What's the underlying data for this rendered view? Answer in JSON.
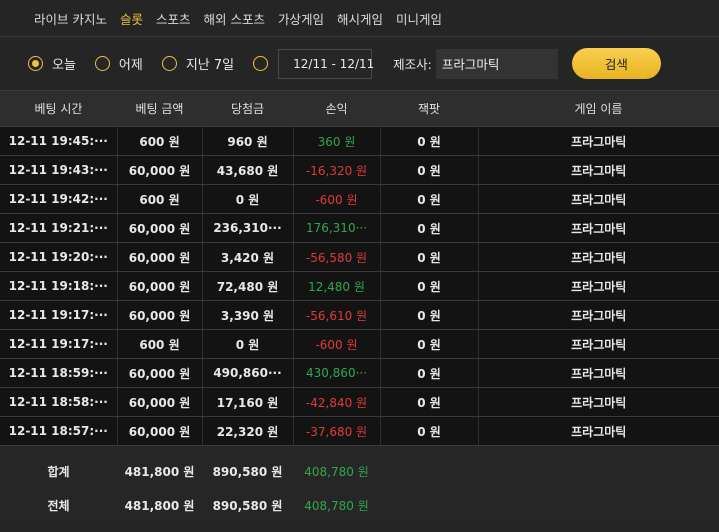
{
  "tabs": [
    {
      "label": "라이브 카지노",
      "active": false
    },
    {
      "label": "슬롯",
      "active": true
    },
    {
      "label": "스포츠",
      "active": false
    },
    {
      "label": "해외 스포츠",
      "active": false
    },
    {
      "label": "가상게임",
      "active": false
    },
    {
      "label": "해시게임",
      "active": false
    },
    {
      "label": "미니게임",
      "active": false
    }
  ],
  "filters": {
    "periods": [
      {
        "label": "오늘",
        "selected": true
      },
      {
        "label": "어제",
        "selected": false
      },
      {
        "label": "지난 7일",
        "selected": false
      }
    ],
    "date_range": "12/11 - 12/11",
    "maker_label": "제조사:",
    "maker_value": "프라그마틱",
    "search_label": "검색"
  },
  "table": {
    "headers": [
      "베팅 시간",
      "베팅 금액",
      "당첨금",
      "손익",
      "잭팟",
      "게임 이름"
    ],
    "rows": [
      {
        "time": "12-11 19:45:···",
        "bet": "600 원",
        "win": "960 원",
        "pnl": "360 원",
        "pnl_sign": "pos",
        "jackpot": "0 원",
        "game": "프라그마틱"
      },
      {
        "time": "12-11 19:43:···",
        "bet": "60,000 원",
        "win": "43,680 원",
        "pnl": "-16,320 원",
        "pnl_sign": "neg",
        "jackpot": "0 원",
        "game": "프라그마틱"
      },
      {
        "time": "12-11 19:42:···",
        "bet": "600 원",
        "win": "0 원",
        "pnl": "-600 원",
        "pnl_sign": "neg",
        "jackpot": "0 원",
        "game": "프라그마틱"
      },
      {
        "time": "12-11 19:21:···",
        "bet": "60,000 원",
        "win": "236,310···",
        "pnl": "176,310···",
        "pnl_sign": "pos",
        "jackpot": "0 원",
        "game": "프라그마틱"
      },
      {
        "time": "12-11 19:20:···",
        "bet": "60,000 원",
        "win": "3,420 원",
        "pnl": "-56,580 원",
        "pnl_sign": "neg",
        "jackpot": "0 원",
        "game": "프라그마틱"
      },
      {
        "time": "12-11 19:18:···",
        "bet": "60,000 원",
        "win": "72,480 원",
        "pnl": "12,480 원",
        "pnl_sign": "pos",
        "jackpot": "0 원",
        "game": "프라그마틱"
      },
      {
        "time": "12-11 19:17:···",
        "bet": "60,000 원",
        "win": "3,390 원",
        "pnl": "-56,610 원",
        "pnl_sign": "neg",
        "jackpot": "0 원",
        "game": "프라그마틱"
      },
      {
        "time": "12-11 19:17:···",
        "bet": "600 원",
        "win": "0 원",
        "pnl": "-600 원",
        "pnl_sign": "neg",
        "jackpot": "0 원",
        "game": "프라그마틱"
      },
      {
        "time": "12-11 18:59:···",
        "bet": "60,000 원",
        "win": "490,860···",
        "pnl": "430,860···",
        "pnl_sign": "pos",
        "jackpot": "0 원",
        "game": "프라그마틱"
      },
      {
        "time": "12-11 18:58:···",
        "bet": "60,000 원",
        "win": "17,160 원",
        "pnl": "-42,840 원",
        "pnl_sign": "neg",
        "jackpot": "0 원",
        "game": "프라그마틱"
      },
      {
        "time": "12-11 18:57:···",
        "bet": "60,000 원",
        "win": "22,320 원",
        "pnl": "-37,680 원",
        "pnl_sign": "neg",
        "jackpot": "0 원",
        "game": "프라그마틱"
      }
    ],
    "summary": [
      {
        "label": "합계",
        "bet": "481,800 원",
        "win": "890,580 원",
        "pnl": "408,780 원"
      },
      {
        "label": "전체",
        "bet": "481,800 원",
        "win": "890,580 원",
        "pnl": "408,780 원"
      }
    ]
  },
  "colors": {
    "accent": "#f0c040",
    "positive": "#2ea84a",
    "negative": "#e03a3a"
  },
  "icons": {
    "date": "calendar-icon"
  }
}
